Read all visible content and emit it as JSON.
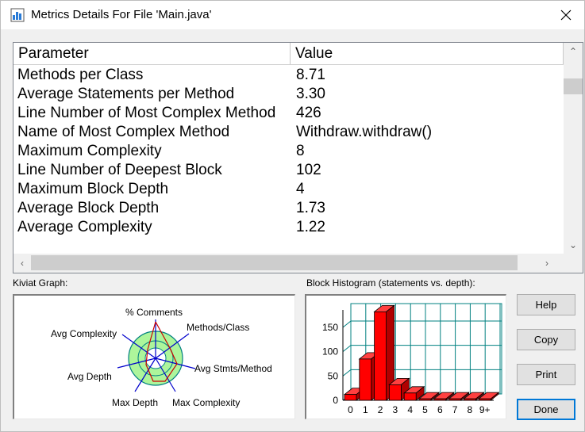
{
  "window": {
    "title": "Metrics Details For File 'Main.java'",
    "icon": "metrics-app-icon",
    "close_icon": "close-icon"
  },
  "table": {
    "columns": [
      "Parameter",
      "Value"
    ],
    "rows": [
      {
        "parameter": "Methods per Class",
        "value": "8.71"
      },
      {
        "parameter": "Average Statements per Method",
        "value": "3.30"
      },
      {
        "parameter": "Line Number of Most Complex Method",
        "value": "426"
      },
      {
        "parameter": "Name of Most Complex Method",
        "value": "Withdraw.withdraw()"
      },
      {
        "parameter": "Maximum Complexity",
        "value": "8"
      },
      {
        "parameter": "Line Number of Deepest Block",
        "value": "102"
      },
      {
        "parameter": "Maximum Block Depth",
        "value": "4"
      },
      {
        "parameter": "Average Block Depth",
        "value": "1.73"
      },
      {
        "parameter": "Average Complexity",
        "value": "1.22"
      }
    ],
    "scroll_up_icon": "chevron-up-icon",
    "scroll_down_icon": "chevron-down-icon",
    "scroll_left_icon": "chevron-left-icon",
    "scroll_right_icon": "chevron-right-icon"
  },
  "kiviat": {
    "label": "Kiviat Graph:",
    "axes": [
      "% Comments",
      "Methods/Class",
      "Avg Stmts/Method",
      "Max Complexity",
      "Max Depth",
      "Avg Depth",
      "Avg Complexity"
    ],
    "colors": {
      "ring_fill": "#adf59b",
      "inner": "#ffffff",
      "axis": "#0000cc",
      "value_line": "#cc0000"
    }
  },
  "histogram": {
    "label": "Block Histogram (statements vs. depth):",
    "colors": {
      "bar": "#ff0000",
      "grid": "#008080",
      "wall": "#ffffff"
    }
  },
  "chart_data": {
    "type": "bar",
    "title": "Block Histogram (statements vs. depth):",
    "categories": [
      "0",
      "1",
      "2",
      "3",
      "4",
      "5",
      "6",
      "7",
      "8",
      "9+"
    ],
    "values": [
      12,
      85,
      182,
      32,
      15,
      3,
      3,
      3,
      3,
      3
    ],
    "ylim": [
      0,
      180
    ],
    "yticks": [
      "0",
      "50",
      "100",
      "150"
    ],
    "grid": true,
    "style": "3d"
  },
  "buttons": {
    "help": "Help",
    "copy": "Copy",
    "print": "Print",
    "done": "Done"
  }
}
